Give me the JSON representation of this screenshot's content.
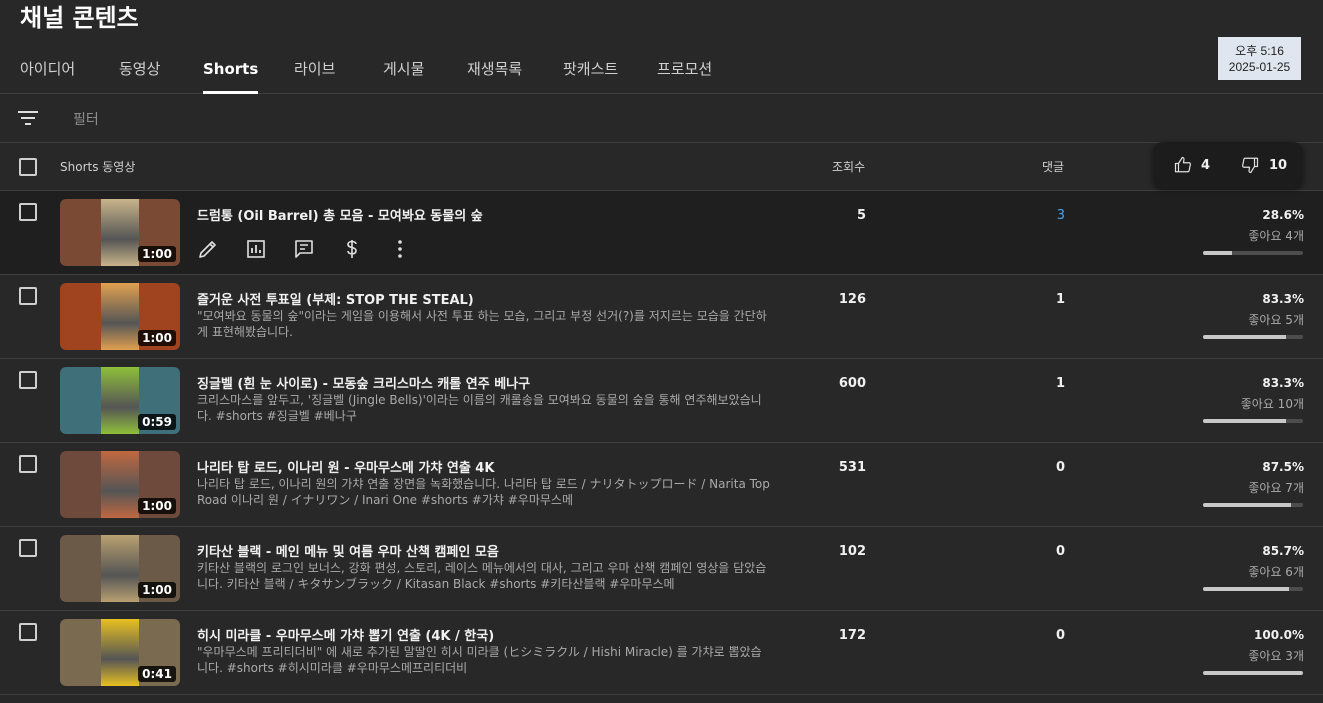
{
  "page": {
    "title": "채널 콘텐츠"
  },
  "clock": {
    "time": "오후 5:16",
    "date": "2025-01-25"
  },
  "tabs": [
    {
      "label": "아이디어"
    },
    {
      "label": "동영상"
    },
    {
      "label": "Shorts",
      "active": true
    },
    {
      "label": "라이브"
    },
    {
      "label": "게시물"
    },
    {
      "label": "재생목록"
    },
    {
      "label": "팟캐스트"
    },
    {
      "label": "프로모션"
    }
  ],
  "filter": {
    "placeholder": "필터",
    "icon": "filter-icon"
  },
  "table": {
    "headers": {
      "video": "Shorts 동영상",
      "views": "조회수",
      "comments": "댓글"
    },
    "rating_tooltip": {
      "likes": "4",
      "dislikes": "10",
      "like_icon": "thumbs-up-icon",
      "dislike_icon": "thumbs-down-icon"
    },
    "row_actions": [
      "edit-icon",
      "analytics-icon",
      "comments-icon",
      "monetization-icon",
      "more-icon"
    ],
    "rows": [
      {
        "title": "드럼통 (Oil Barrel) 총 모음 - 모여봐요 동물의 숲",
        "description": "",
        "duration": "1:00",
        "views": "5",
        "comments": "3",
        "like_pct": "28.6%",
        "like_count": "좋아요 4개",
        "like_ratio": 0.286,
        "thumb_color": "#7a4a35",
        "thumb_mid": "#c8b48a"
      },
      {
        "title": "즐거운 사전 투표일 (부제: STOP THE STEAL)",
        "description": "\"모여봐요 동물의 숲\"이라는 게임을 이용해서 사전 투표 하는 모습, 그리고 부정 선거(?)를 저지르는 모습을 간단하게 표현해봤습니다.",
        "duration": "1:00",
        "views": "126",
        "comments": "1",
        "like_pct": "83.3%",
        "like_count": "좋아요 5개",
        "like_ratio": 0.833,
        "thumb_color": "#a0441f",
        "thumb_mid": "#e0a050"
      },
      {
        "title": "징글벨 (흰 눈 사이로) - 모동숲 크리스마스 캐롤 연주 베나구",
        "description": "크리스마스를 앞두고, '징글벨 (Jingle Bells)'이라는 이름의 캐롤송을 모여봐요 동물의 숲을 통해 연주해보았습니다. #shorts #징글벨 #베나구",
        "duration": "0:59",
        "views": "600",
        "comments": "1",
        "like_pct": "83.3%",
        "like_count": "좋아요 10개",
        "like_ratio": 0.833,
        "thumb_color": "#3f6f78",
        "thumb_mid": "#8fbf3a"
      },
      {
        "title": "나리타 탑 로드, 이나리 원 - 우마무스메 가챠 연출 4K",
        "description": "나리타 탑 로드, 이나리 원의 가챠 연출 장면을 녹화했습니다. 나리타 탑 로드 / ナリタトップロード / Narita Top Road 이나리 원 / イナリワン / Inari One #shorts #가챠 #우마무스메",
        "duration": "1:00",
        "views": "531",
        "comments": "0",
        "like_pct": "87.5%",
        "like_count": "좋아요 7개",
        "like_ratio": 0.875,
        "thumb_color": "#6d4a3c",
        "thumb_mid": "#c06840"
      },
      {
        "title": "키타산 블랙 - 메인 메뉴 및 여름 우마 산책 캠페인 모음",
        "description": "키타산 블랙의 로그인 보너스, 강화 편성, 스토리, 레이스 메뉴에서의 대사, 그리고 우마 산책 캠페인 영상을 담았습니다. 키타산 블랙 / キタサンブラック / Kitasan Black #shorts #키타산블랙 #우마무스메",
        "duration": "1:00",
        "views": "102",
        "comments": "0",
        "like_pct": "85.7%",
        "like_count": "좋아요 6개",
        "like_ratio": 0.857,
        "thumb_color": "#6b5a48",
        "thumb_mid": "#b8a070"
      },
      {
        "title": "히시 미라클 - 우마무스메 가챠 뽑기 연출 (4K / 한국)",
        "description": "\"우마무스메 프리티더비\" 에 새로 추가된 말딸인 히시 미라클 (ヒシミラクル / Hishi Miracle) 를 가챠로 뽑았습니다. #shorts #히시미라클 #우마무스메프리티더비",
        "duration": "0:41",
        "views": "172",
        "comments": "0",
        "like_pct": "100.0%",
        "like_count": "좋아요 3개",
        "like_ratio": 1.0,
        "thumb_color": "#7a6a50",
        "thumb_mid": "#e8c020"
      }
    ]
  }
}
